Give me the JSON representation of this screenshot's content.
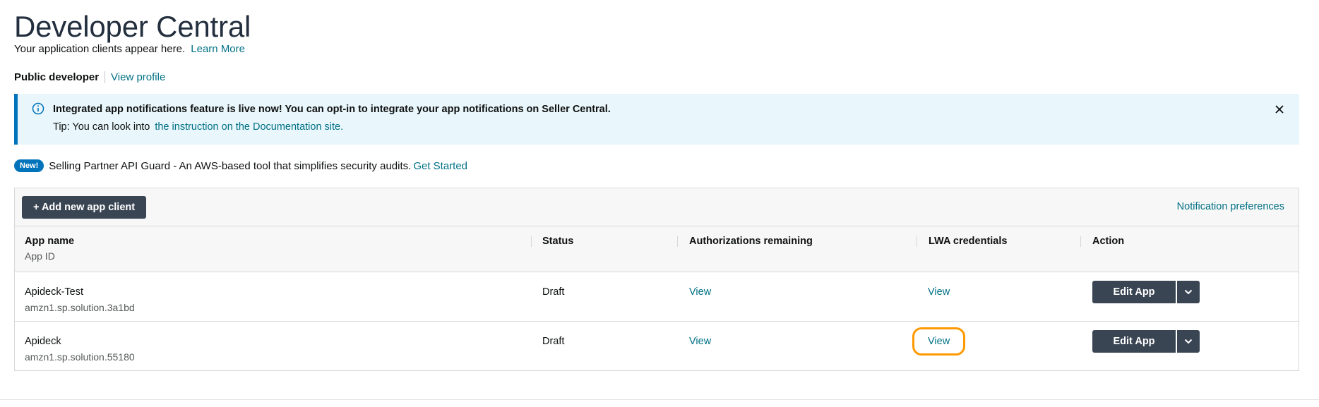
{
  "header": {
    "title": "Developer Central",
    "subtitle": "Your application clients appear here.",
    "learn_more": "Learn More"
  },
  "developer": {
    "type_label": "Public developer",
    "view_profile": "View profile"
  },
  "alert": {
    "title": "Integrated app notifications feature is live now! You can opt-in to integrate your app notifications on Seller Central.",
    "tip_prefix": "Tip: You can look into",
    "tip_link": "the instruction on the Documentation site.",
    "icon": "info-icon",
    "close_icon": "close-icon"
  },
  "announcement": {
    "badge": "New!",
    "text": "Selling Partner API Guard - An AWS-based tool that simplifies security audits.",
    "link": "Get Started"
  },
  "toolbar": {
    "add_button": "+ Add new app client",
    "notification_preferences": "Notification preferences"
  },
  "table": {
    "columns": {
      "app_name": "App name",
      "app_id": "App ID",
      "status": "Status",
      "authorizations": "Authorizations remaining",
      "lwa": "LWA credentials",
      "action": "Action"
    },
    "rows": [
      {
        "name": "Apideck-Test",
        "id": "amzn1.sp.solution.3a1bd",
        "status": "Draft",
        "auth_link": "View",
        "lwa_link": "View",
        "action": "Edit App"
      },
      {
        "name": "Apideck",
        "id": "amzn1.sp.solution.55180",
        "status": "Draft",
        "auth_link": "View",
        "lwa_link": "View",
        "action": "Edit App"
      }
    ]
  },
  "colors": {
    "link": "#007185",
    "button": "#3a4553",
    "alert_bg": "#e9f6fb",
    "alert_border": "#0073bb",
    "highlight": "#ff9900"
  }
}
